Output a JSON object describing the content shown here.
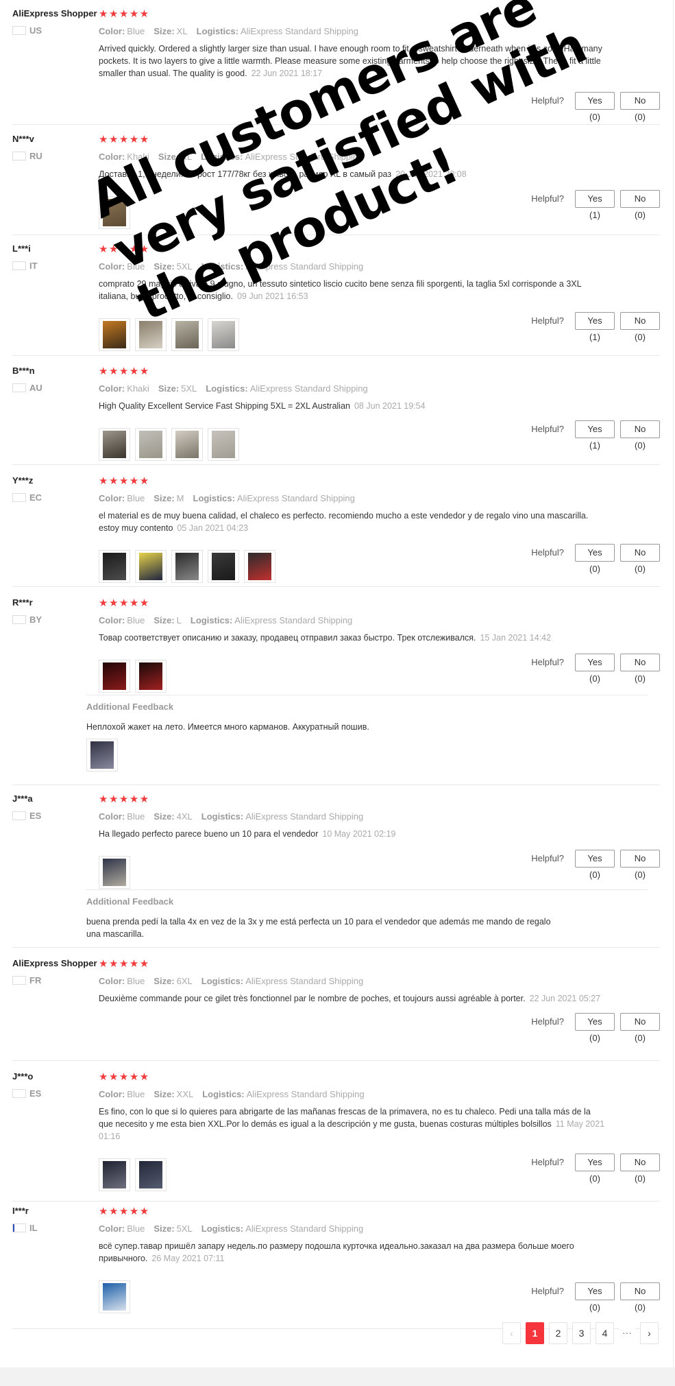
{
  "labels": {
    "color": "Color:",
    "size": "Size:",
    "logistics": "Logistics:",
    "helpful": "Helpful?",
    "additional_feedback": "Additional Feedback",
    "stars": "★★★★★"
  },
  "overlay": {
    "line1": "All customers are",
    "line2": "very satisfied with",
    "line3": "the product!"
  },
  "accent_color": "#f5353b",
  "star_color": "#f03c3c",
  "reviews": [
    {
      "user": "AliExpress Shopper",
      "country": "US",
      "flag": "flag-us-icon",
      "rating": 5,
      "color": "Blue",
      "size": "XL",
      "logistics": "AliExpress Standard Shipping",
      "text": "Arrived quickly. Ordered a slightly larger size than usual. I have enough room to fit a sweatshirt underneath when it is cold. Has many pockets. It is two layers to give a little warmth. Please measure some existing garments to help choose the right size. These fit a little smaller than usual. The quality is good.",
      "date": "22 Jun 2021 18:17",
      "yes": "Yes (0)",
      "no": "No (0)"
    },
    {
      "user": "N***v",
      "country": "RU",
      "flag": "flag-ru-icon",
      "rating": 5,
      "color": "Khaki",
      "size": "XL",
      "logistics": "AliExpress Standard Shipping",
      "text": "Доставка 1,5 недели. на рост 177/78кг без живота размер XL в самый раз",
      "date": "20 Jun 2021 20:08",
      "yes": "Yes (1)",
      "no": "No (0)"
    },
    {
      "user": "L***i",
      "country": "IT",
      "flag": "flag-it-icon",
      "rating": 5,
      "color": "Blue",
      "size": "5XL",
      "logistics": "AliExpress Standard Shipping",
      "text": "comprato 29 maggio arrivato 9 giugno, un tessuto sintetico liscio cucito bene senza fili sporgenti, la taglia 5xl corrisponde a 3XL italiana, buon prodotto, lo consiglio.",
      "date": "09 Jun 2021 16:53",
      "yes": "Yes (1)",
      "no": "No (0)"
    },
    {
      "user": "B***n",
      "country": "AU",
      "flag": "flag-au-icon",
      "rating": 5,
      "color": "Khaki",
      "size": "5XL",
      "logistics": "AliExpress Standard Shipping",
      "text": "High Quality Excellent Service Fast Shipping 5XL = 2XL Australian",
      "date": "08 Jun 2021 19:54",
      "yes": "Yes (1)",
      "no": "No (0)"
    },
    {
      "user": "Y***z",
      "country": "EC",
      "flag": "flag-ec-icon",
      "rating": 5,
      "color": "Blue",
      "size": "M",
      "logistics": "AliExpress Standard Shipping",
      "text": "el material es de muy buena calidad, el chaleco es perfecto. recomiendo mucho a este vendedor y de regalo vino una mascarilla. estoy muy contento",
      "date": "05 Jan 2021 04:23",
      "yes": "Yes (0)",
      "no": "No (0)"
    },
    {
      "user": "R***r",
      "country": "BY",
      "flag": "flag-by-icon",
      "rating": 5,
      "color": "Blue",
      "size": "L",
      "logistics": "AliExpress Standard Shipping",
      "text": "Товар соответствует описанию и заказу, продавец отправил заказ быстро. Трек отслеживался.",
      "date": "15 Jan 2021 14:42",
      "yes": "Yes (0)",
      "no": "No (0)",
      "feedback": "Неплохой жакет на лето. Имеется много карманов. Аккуратный пошив."
    },
    {
      "user": "J***a",
      "country": "ES",
      "flag": "flag-es-icon",
      "rating": 5,
      "color": "Blue",
      "size": "4XL",
      "logistics": "AliExpress Standard Shipping",
      "text": "Ha llegado perfecto parece bueno un 10 para el vendedor",
      "date": "10 May 2021 02:19",
      "yes": "Yes (0)",
      "no": "No (0)",
      "feedback": "buena prenda pedí la talla 4x en vez de la 3x y me está perfecta un 10 para el vendedor que además me mando de regalo una mascarilla."
    },
    {
      "user": "AliExpress Shopper",
      "country": "FR",
      "flag": "flag-fr-icon",
      "rating": 5,
      "color": "Blue",
      "size": "6XL",
      "logistics": "AliExpress Standard Shipping",
      "text": "Deuxième commande pour ce gilet très fonctionnel par le nombre de poches, et toujours aussi agréable à porter.",
      "date": "22 Jun 2021 05:27",
      "yes": "Yes (0)",
      "no": "No (0)"
    },
    {
      "user": "J***o",
      "country": "ES",
      "flag": "flag-es-icon",
      "rating": 5,
      "color": "Blue",
      "size": "XXL",
      "logistics": "AliExpress Standard Shipping",
      "text": "Es fino, con lo que si lo quieres para abrigarte de las mañanas frescas de la primavera, no es tu chaleco. Pedi una talla más de la que necesito y me esta bien XXL.Por lo demás es igual a la descripción y me gusta, buenas costuras múltiples bolsillos",
      "date": "11 May 2021 01:16",
      "yes": "Yes (0)",
      "no": "No (0)"
    },
    {
      "user": "I***r",
      "country": "IL",
      "flag": "flag-il-icon",
      "rating": 5,
      "color": "Blue",
      "size": "5XL",
      "logistics": "AliExpress Standard Shipping",
      "text": "всё супер.тавар пришёл запару недель.по размеру подошла курточка идеально.заказал на два размера больше моего привычного.",
      "date": "26 May 2021 07:11",
      "yes": "Yes (0)",
      "no": "No (0)"
    }
  ],
  "pagination": {
    "prev": "‹",
    "pages": [
      "1",
      "2",
      "3",
      "4"
    ],
    "ellipsis": "···",
    "next": "›",
    "current": "1"
  }
}
